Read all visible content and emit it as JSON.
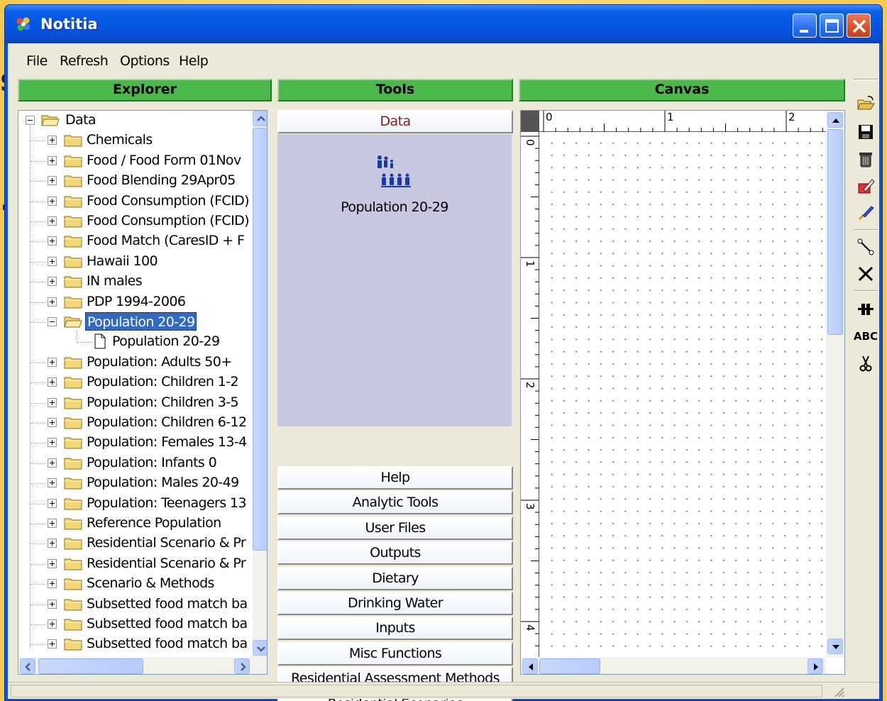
{
  "window": {
    "title": "Notitia"
  },
  "menu": [
    "File",
    "Refresh",
    "Options",
    "Help"
  ],
  "panes": {
    "explorer": "Explorer",
    "tools": "Tools",
    "canvas": "Canvas"
  },
  "explorer": {
    "root": "Data",
    "items": [
      "Chemicals",
      "Food / Food Form 01Nov",
      "Food Blending 29Apr05",
      "Food Consumption (FCID)",
      "Food Consumption (FCID)",
      "Food Match (CaresID + F",
      "Hawaii 100",
      "IN males",
      "PDP 1994-2006",
      "Population 20-29",
      "Population: Adults 50+",
      "Population: Children 1-2",
      "Population: Children 3-5",
      "Population: Children 6-12",
      "Population: Females 13-4",
      "Population: Infants 0",
      "Population: Males 20-49",
      "Population: Teenagers 13",
      "Reference Population",
      "Residential Scenario & Pr",
      "Residential Scenario & Pr",
      "Scenario & Methods",
      "Subsetted food match ba",
      "Subsetted food match ba",
      "Subsetted food match ba"
    ],
    "selected_child": "Population 20-29"
  },
  "tools": {
    "active_tab": "Data",
    "item_label": "Population 20-29",
    "tabs": [
      "Help",
      "Analytic Tools",
      "User Files",
      "Outputs",
      "Dietary",
      "Drinking Water",
      "Inputs",
      "Misc Functions",
      "Residential Assessment Methods",
      "Residential Scenarios"
    ]
  },
  "canvas": {
    "ruler_top": [
      "0",
      "1",
      "2"
    ],
    "ruler_left": [
      "0",
      "1",
      "2",
      "3",
      "4"
    ]
  },
  "toolbar_icons": [
    "open-icon",
    "save-icon",
    "delete-icon",
    "edit-icon",
    "run-icon",
    "connect-icon",
    "remove-connection-icon",
    "align-icon",
    "text-icon",
    "cut-icon"
  ],
  "toolbar_text": {
    "abc": "ABC"
  }
}
